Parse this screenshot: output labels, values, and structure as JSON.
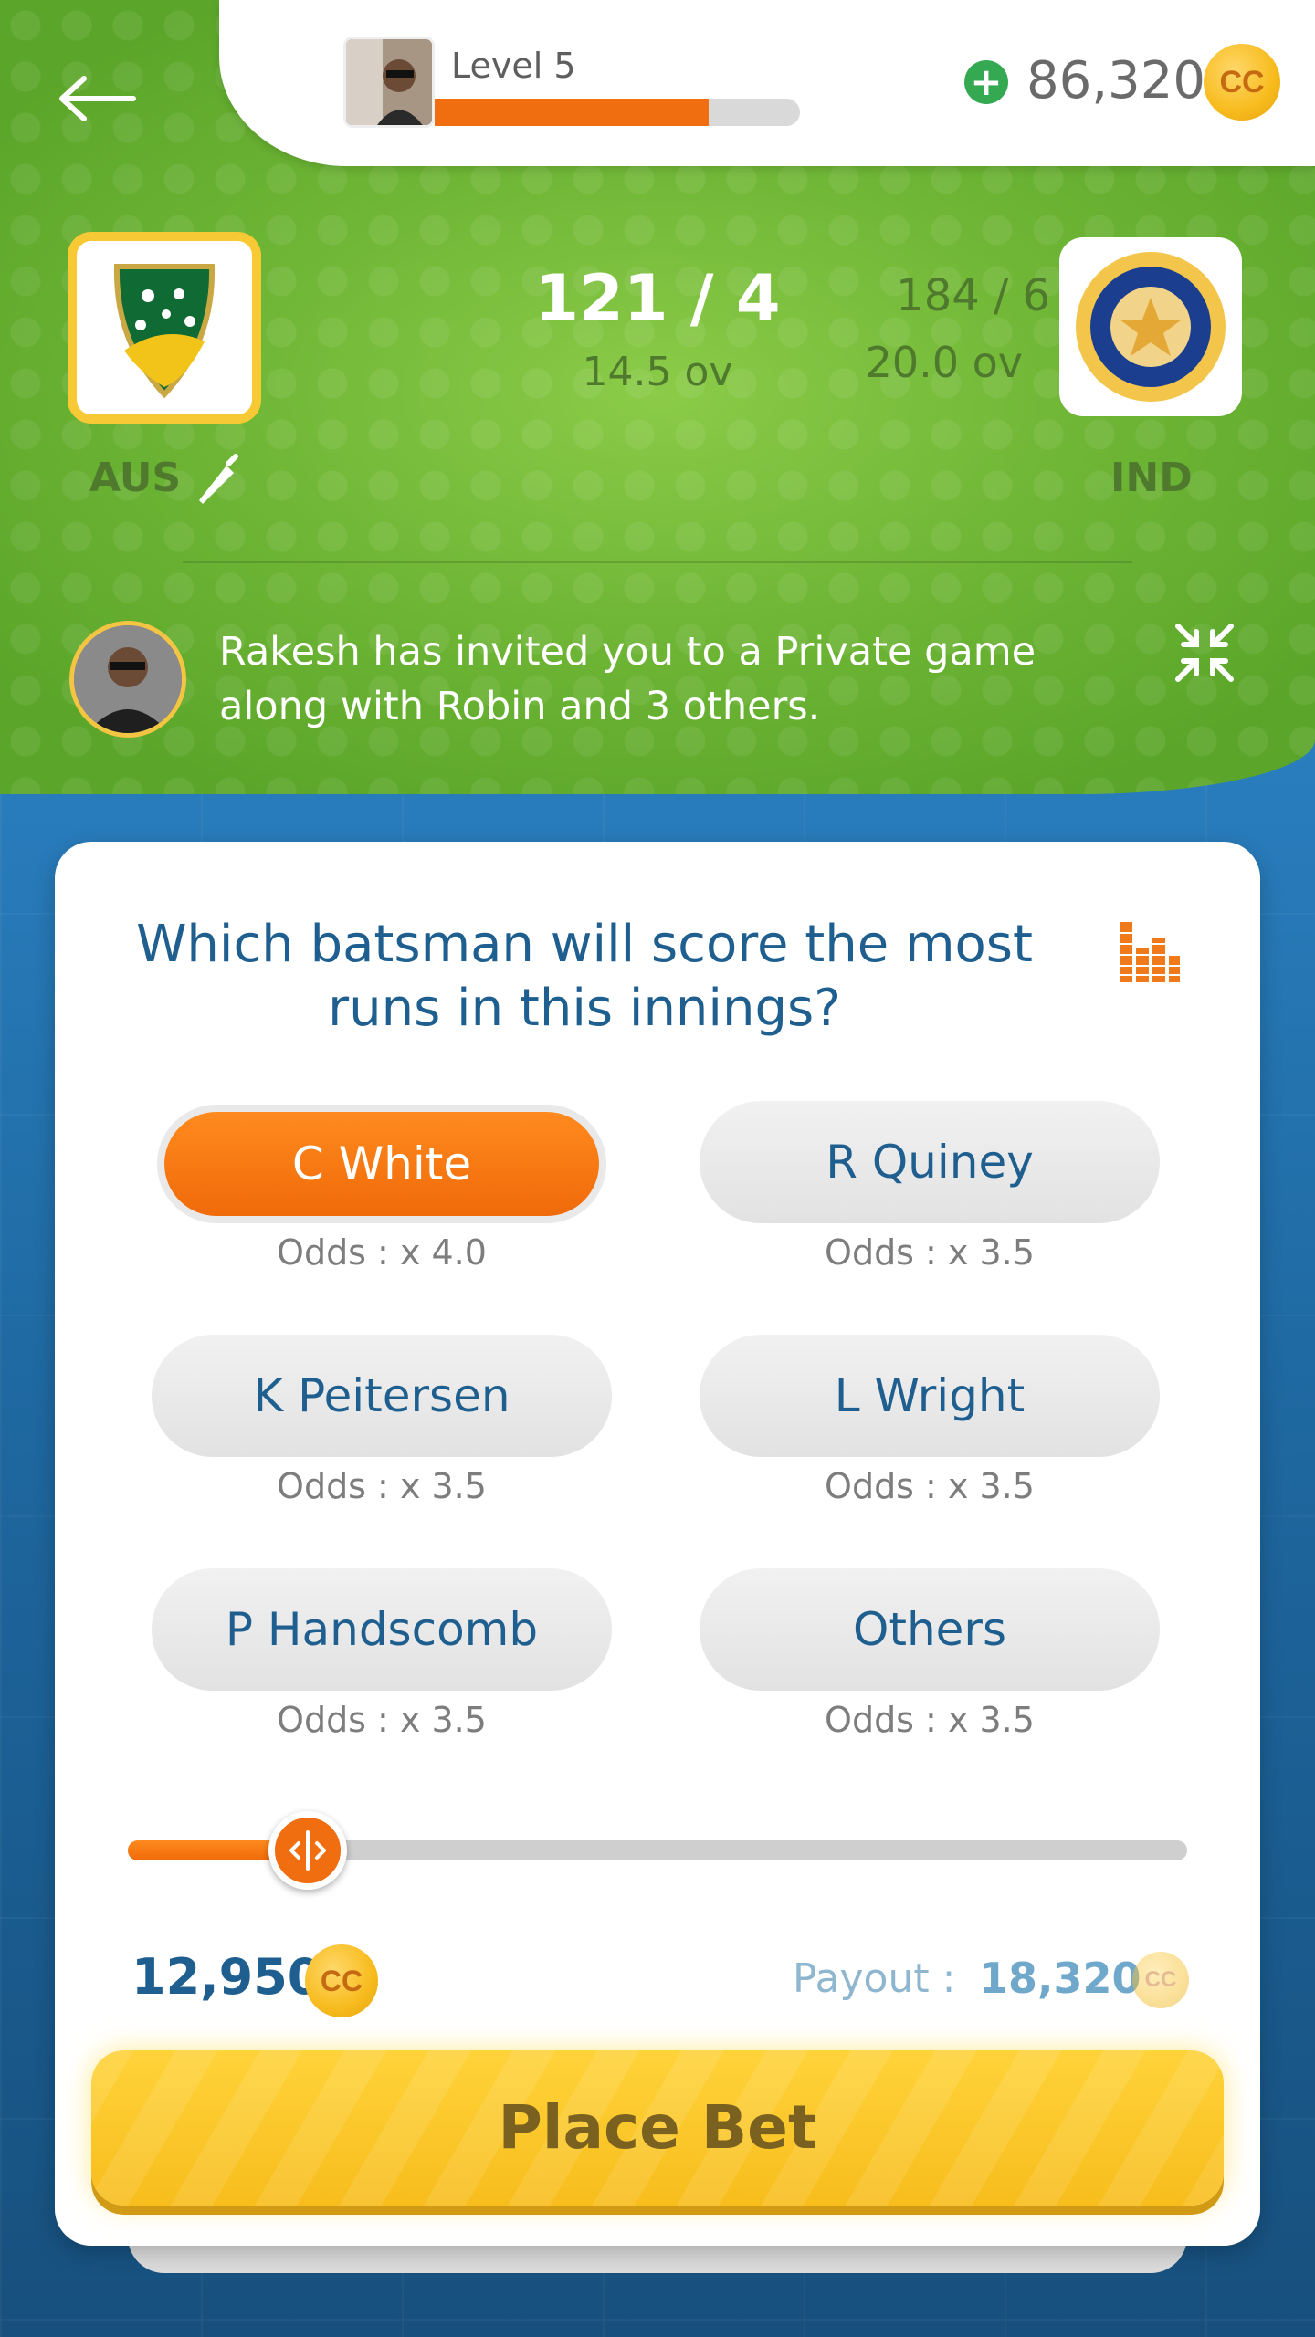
{
  "header": {
    "back_icon": "arrow-left-icon",
    "level_label": "Level 5",
    "level_progress": 0.75,
    "coin_balance": "86,320",
    "coin_symbol": "CC"
  },
  "match": {
    "team_home": {
      "code": "AUS",
      "score": "121 / 4",
      "overs": "14.5 ov",
      "batting_icon": "cricket-bat-icon"
    },
    "team_away": {
      "code": "IND",
      "score": "184 / 6",
      "overs": "20.0 ov"
    }
  },
  "invite": {
    "text": "Rakesh has invited you to a Private game along with Robin and 3 others.",
    "collapse_icon": "collapse-arrows-icon"
  },
  "question": {
    "text": "Which batsman will score the most runs in this innings?",
    "stats_icon": "bar-chart-icon"
  },
  "options": [
    {
      "label": "C White",
      "odds": "Odds : x 4.0",
      "selected": true
    },
    {
      "label": "R Quiney",
      "odds": "Odds : x 3.5",
      "selected": false
    },
    {
      "label": "K Peitersen",
      "odds": "Odds : x 3.5",
      "selected": false
    },
    {
      "label": "L Wright",
      "odds": "Odds : x 3.5",
      "selected": false
    },
    {
      "label": "P Handscomb",
      "odds": "Odds : x 3.5",
      "selected": false
    },
    {
      "label": "Others",
      "odds": "Odds : x 3.5",
      "selected": false
    }
  ],
  "bet": {
    "slider_fraction": 0.17,
    "amount": "12,950",
    "amount_symbol": "CC",
    "payout_label": "Payout :",
    "payout_value": "18,320",
    "payout_symbol": "CC",
    "place_bet_label": "Place Bet"
  },
  "colors": {
    "accent_orange": "#f06e0f",
    "primary_blue": "#1f5f8f",
    "header_green": "#6eb535",
    "gold": "#f7bd1c"
  }
}
